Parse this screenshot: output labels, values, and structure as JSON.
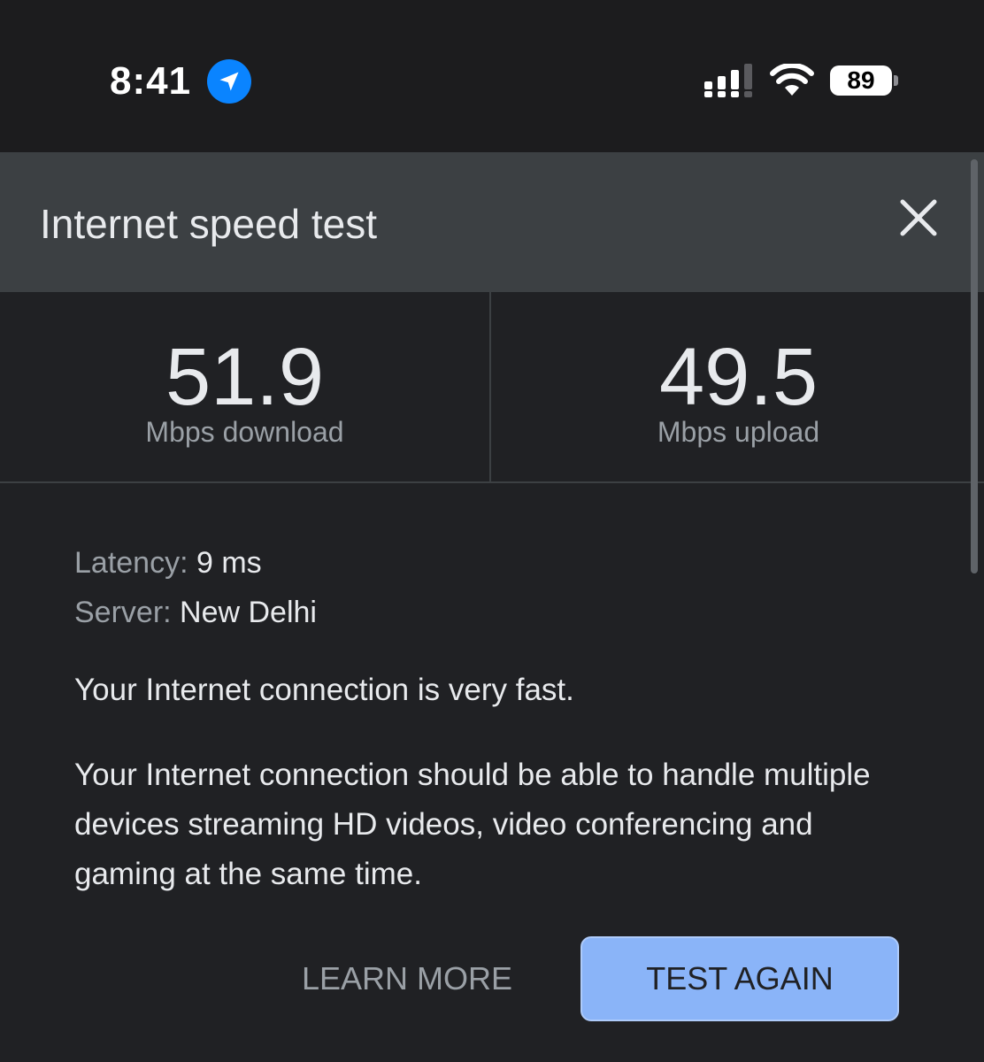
{
  "status_bar": {
    "time": "8:41",
    "battery_level": "89",
    "icons": [
      "location-arrow-icon",
      "cellular-signal-icon",
      "wifi-icon",
      "battery-icon"
    ]
  },
  "header": {
    "title": "Internet speed test",
    "close_icon": "close-icon"
  },
  "results": {
    "download": {
      "value": "51.9",
      "unit": "Mbps download"
    },
    "upload": {
      "value": "49.5",
      "unit": "Mbps upload"
    }
  },
  "details": {
    "latency_label": "Latency:",
    "latency_value": " 9 ms",
    "server_label": "Server:",
    "server_value": " New Delhi"
  },
  "summary": "Your Internet connection is very fast.",
  "description": "Your Internet connection should be able to handle multiple devices streaming HD videos, video conferencing and gaming at the same time.",
  "actions": {
    "learn_more": "LEARN MORE",
    "test_again": "TEST AGAIN"
  },
  "colors": {
    "background": "#202124",
    "header": "#3c4043",
    "accent": "#8ab4f8",
    "secondary_text": "#9aa0a6",
    "location_badge": "#0a84ff"
  }
}
